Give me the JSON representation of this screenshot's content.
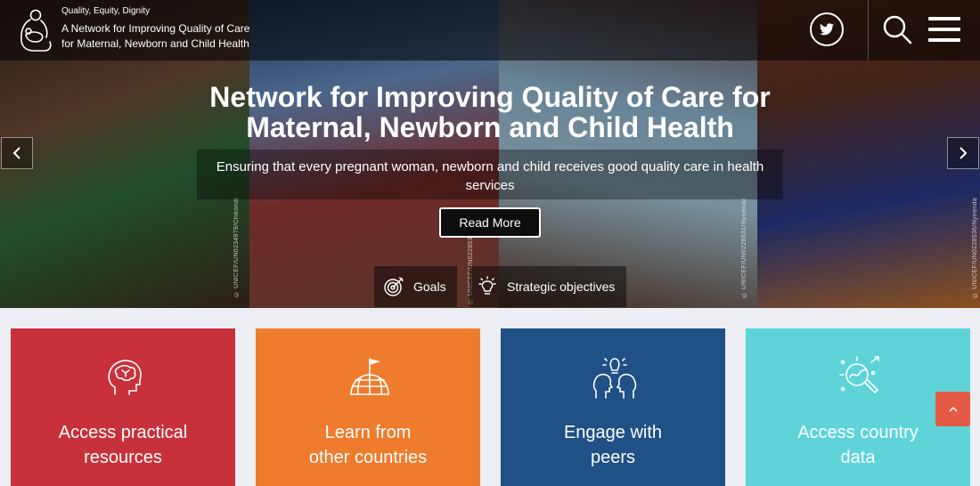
{
  "header": {
    "tagline": "Quality, Equity, Dignity",
    "brand_line1": "A Network for Improving Quality of Care",
    "brand_line2": "for Maternal, Newborn and Child Health"
  },
  "photo_credits": [
    "© UNICEF/UN0234979/Chikondi",
    "© UNICEF/UN0228530",
    "© UNICEF/UN0228531/Nyirenda",
    "© UNICEF/UN0228536/Nyirenda"
  ],
  "hero": {
    "title_line1": "Network for Improving Quality of Care for",
    "title_line2": "Maternal, Newborn and Child Health",
    "subtitle": "Ensuring that every pregnant woman, newborn and child receives good quality care in health services",
    "cta_label": "Read More"
  },
  "quick_links": [
    {
      "label": "Goals",
      "icon": "target-icon"
    },
    {
      "label": "Strategic objectives",
      "icon": "lightbulb-icon"
    }
  ],
  "cards": [
    {
      "line1": "Access practical",
      "line2": "resources",
      "icon": "brain-head-icon",
      "color": "#c8313a"
    },
    {
      "line1": "Learn from",
      "line2": "other countries",
      "icon": "globe-flag-icon",
      "color": "#ef7b2c"
    },
    {
      "line1": "Engage with",
      "line2": "peers",
      "icon": "peers-idea-icon",
      "color": "#1f5086"
    },
    {
      "line1": "Access country",
      "line2": "data",
      "icon": "data-magnifier-icon",
      "color": "#5ed4d9"
    }
  ]
}
